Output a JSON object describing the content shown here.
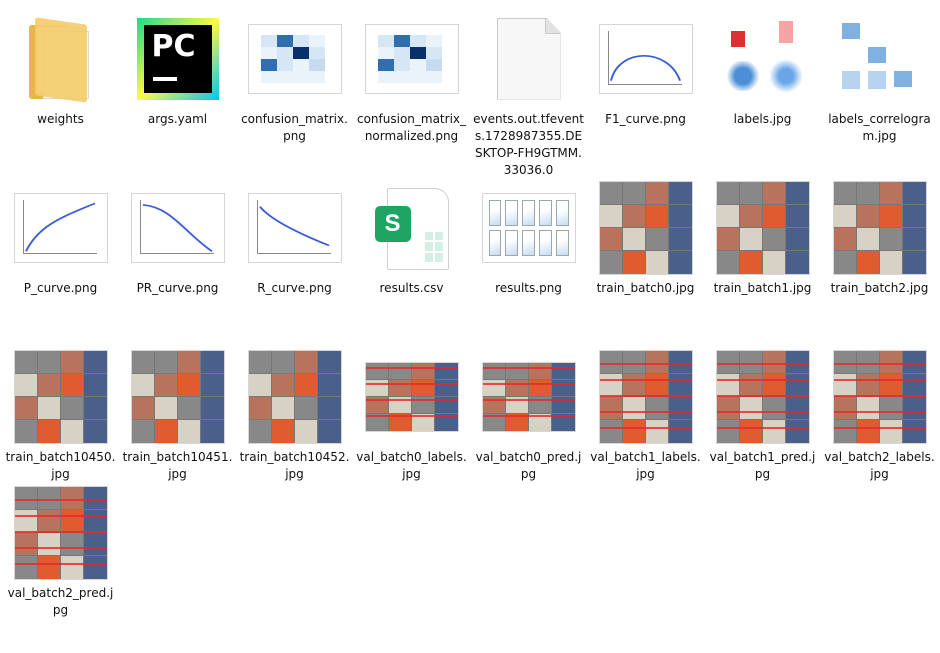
{
  "files": [
    {
      "name": "weights",
      "kind": "folder",
      "icon": "folder-icon"
    },
    {
      "name": "args.yaml",
      "kind": "pycharm",
      "icon": "pycharm-icon"
    },
    {
      "name": "confusion_matrix.png",
      "kind": "confusion",
      "icon": "image-thumbnail-icon"
    },
    {
      "name": "confusion_matrix_normalized.png",
      "kind": "confusion",
      "icon": "image-thumbnail-icon"
    },
    {
      "name": "events.out.tfevents.1728987355.DESKTOP-FH9GTMM.33036.0",
      "kind": "blank",
      "icon": "blank-file-icon"
    },
    {
      "name": "F1_curve.png",
      "kind": "curve-f1",
      "icon": "image-thumbnail-icon"
    },
    {
      "name": "labels.jpg",
      "kind": "labels",
      "icon": "image-thumbnail-icon"
    },
    {
      "name": "labels_correlogram.jpg",
      "kind": "correlogram",
      "icon": "image-thumbnail-icon"
    },
    {
      "name": "P_curve.png",
      "kind": "curve-p",
      "icon": "image-thumbnail-icon"
    },
    {
      "name": "PR_curve.png",
      "kind": "curve-pr",
      "icon": "image-thumbnail-icon"
    },
    {
      "name": "R_curve.png",
      "kind": "curve-r",
      "icon": "image-thumbnail-icon"
    },
    {
      "name": "results.csv",
      "kind": "csv",
      "icon": "spreadsheet-file-icon"
    },
    {
      "name": "results.png",
      "kind": "results",
      "icon": "image-thumbnail-icon"
    },
    {
      "name": "train_batch0.jpg",
      "kind": "mosaic",
      "icon": "image-thumbnail-icon"
    },
    {
      "name": "train_batch1.jpg",
      "kind": "mosaic",
      "icon": "image-thumbnail-icon"
    },
    {
      "name": "train_batch2.jpg",
      "kind": "mosaic",
      "icon": "image-thumbnail-icon"
    },
    {
      "name": "train_batch10450.jpg",
      "kind": "mosaic",
      "icon": "image-thumbnail-icon"
    },
    {
      "name": "train_batch10451.jpg",
      "kind": "mosaic",
      "icon": "image-thumbnail-icon"
    },
    {
      "name": "train_batch10452.jpg",
      "kind": "mosaic",
      "icon": "image-thumbnail-icon"
    },
    {
      "name": "val_batch0_labels.jpg",
      "kind": "val-wide",
      "icon": "image-thumbnail-icon"
    },
    {
      "name": "val_batch0_pred.jpg",
      "kind": "val-wide",
      "icon": "image-thumbnail-icon"
    },
    {
      "name": "val_batch1_labels.jpg",
      "kind": "val-red",
      "icon": "image-thumbnail-icon"
    },
    {
      "name": "val_batch1_pred.jpg",
      "kind": "val-red",
      "icon": "image-thumbnail-icon"
    },
    {
      "name": "val_batch2_labels.jpg",
      "kind": "val-red",
      "icon": "image-thumbnail-icon"
    },
    {
      "name": "val_batch2_pred.jpg",
      "kind": "val-red",
      "icon": "image-thumbnail-icon"
    }
  ]
}
